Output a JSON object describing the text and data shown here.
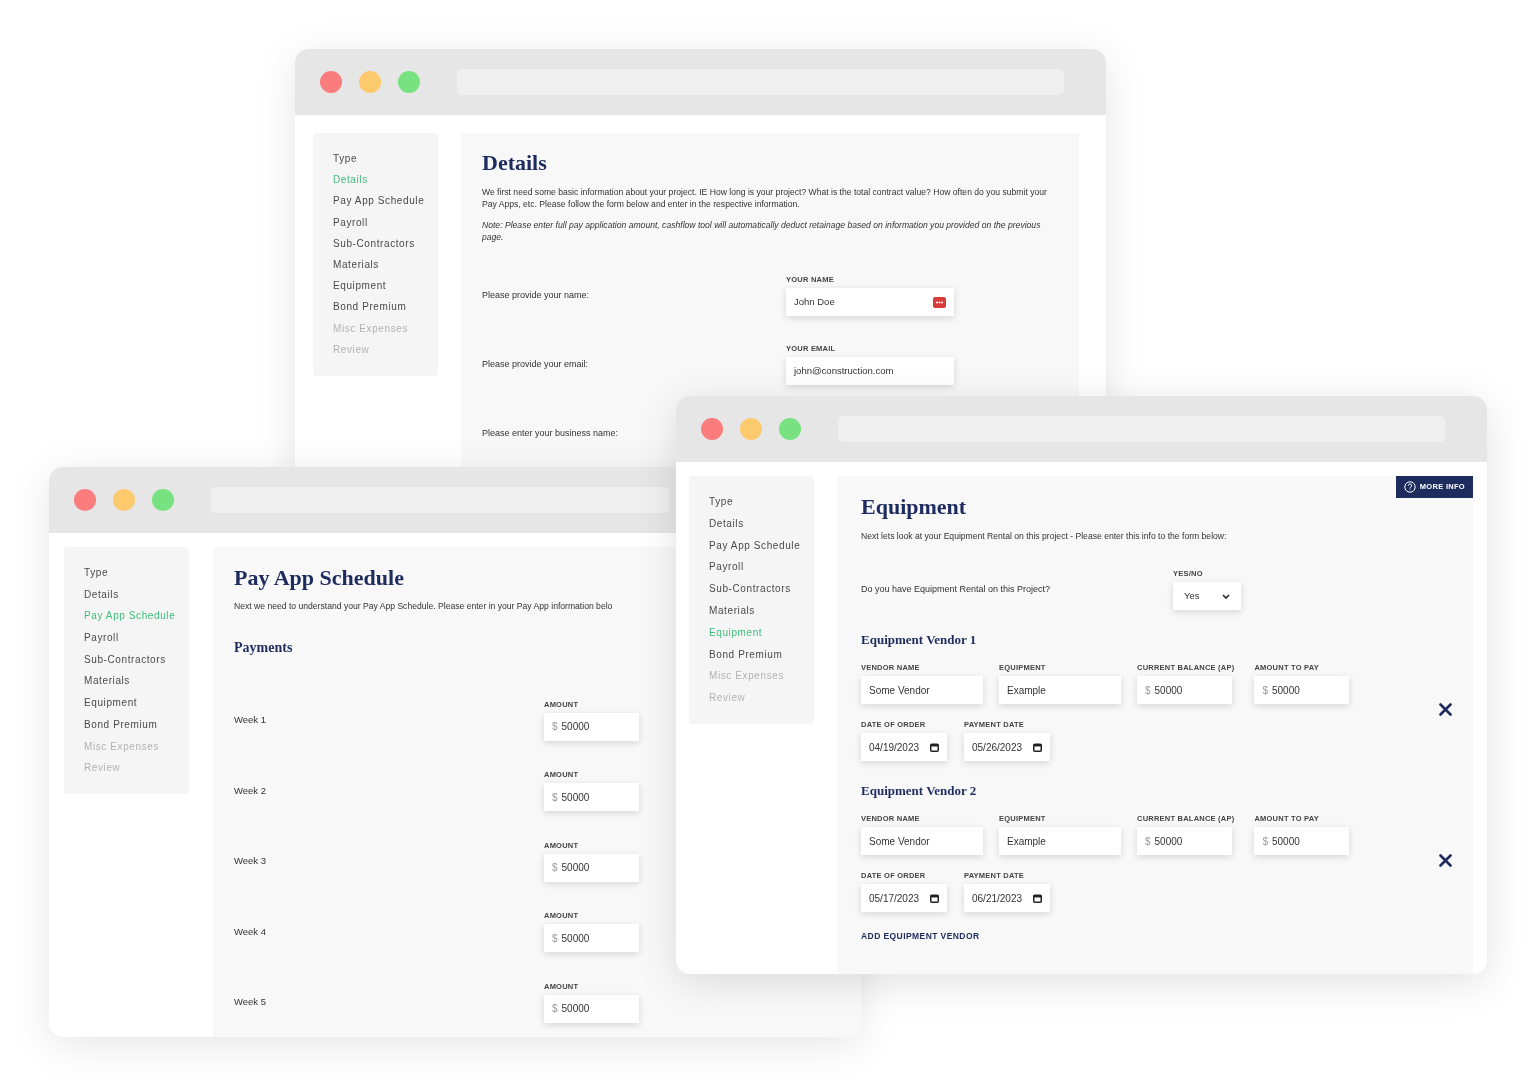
{
  "windows": [
    {
      "kind": "details",
      "sidebar": [
        {
          "label": "Type",
          "selected": false,
          "disabled": false
        },
        {
          "label": "Details",
          "selected": true,
          "disabled": false
        },
        {
          "label": "Pay App Schedule",
          "selected": false,
          "disabled": false
        },
        {
          "label": "Payroll",
          "selected": false,
          "disabled": false
        },
        {
          "label": "Sub-Contractors",
          "selected": false,
          "disabled": false
        },
        {
          "label": "Materials",
          "selected": false,
          "disabled": false
        },
        {
          "label": "Equipment",
          "selected": false,
          "disabled": false
        },
        {
          "label": "Bond Premium",
          "selected": false,
          "disabled": false
        },
        {
          "label": "Misc Expenses",
          "selected": false,
          "disabled": true
        },
        {
          "label": "Review",
          "selected": false,
          "disabled": true
        }
      ],
      "title": "Details",
      "intro": "We first need some basic information about your project. IE How long is your project? What is the total contract value? How often do you submit your Pay Apps, etc. Please follow the form below and enter in the respective information.",
      "note": "Note: Please enter full pay application amount, cashflow tool will automatically deduct retainage based on information you provided on the previous page.",
      "fields": [
        {
          "prompt": "Please provide your name:",
          "label": "YOUR NAME",
          "value": "John Doe",
          "autofill_icon": true
        },
        {
          "prompt": "Please provide your email:",
          "label": "YOUR EMAIL",
          "value": "john@construction.com",
          "autofill_icon": false
        },
        {
          "prompt": "Please enter your business name:"
        }
      ]
    },
    {
      "kind": "pay_app",
      "sidebar": [
        {
          "label": "Type",
          "selected": false,
          "disabled": false
        },
        {
          "label": "Details",
          "selected": false,
          "disabled": false
        },
        {
          "label": "Pay App Schedule",
          "selected": true,
          "disabled": false
        },
        {
          "label": "Payroll",
          "selected": false,
          "disabled": false
        },
        {
          "label": "Sub-Contractors",
          "selected": false,
          "disabled": false
        },
        {
          "label": "Materials",
          "selected": false,
          "disabled": false
        },
        {
          "label": "Equipment",
          "selected": false,
          "disabled": false
        },
        {
          "label": "Bond Premium",
          "selected": false,
          "disabled": false
        },
        {
          "label": "Misc Expenses",
          "selected": false,
          "disabled": true
        },
        {
          "label": "Review",
          "selected": false,
          "disabled": true
        }
      ],
      "title": "Pay App Schedule",
      "intro": "Next we need to understand your Pay App Schedule. Please enter in your Pay App information belo",
      "section": "Payments",
      "weeks": [
        {
          "label": "Week 1",
          "amount_label": "AMOUNT",
          "currency": "$",
          "value": "50000"
        },
        {
          "label": "Week 2",
          "amount_label": "AMOUNT",
          "currency": "$",
          "value": "50000"
        },
        {
          "label": "Week 3",
          "amount_label": "AMOUNT",
          "currency": "$",
          "value": "50000"
        },
        {
          "label": "Week 4",
          "amount_label": "AMOUNT",
          "currency": "$",
          "value": "50000"
        },
        {
          "label": "Week 5",
          "amount_label": "AMOUNT",
          "currency": "$",
          "value": "50000"
        }
      ]
    },
    {
      "kind": "equipment",
      "sidebar": [
        {
          "label": "Type",
          "selected": false,
          "disabled": false
        },
        {
          "label": "Details",
          "selected": false,
          "disabled": false
        },
        {
          "label": "Pay App Schedule",
          "selected": false,
          "disabled": false
        },
        {
          "label": "Payroll",
          "selected": false,
          "disabled": false
        },
        {
          "label": "Sub-Contractors",
          "selected": false,
          "disabled": false
        },
        {
          "label": "Materials",
          "selected": false,
          "disabled": false
        },
        {
          "label": "Equipment",
          "selected": true,
          "disabled": false
        },
        {
          "label": "Bond Premium",
          "selected": false,
          "disabled": false
        },
        {
          "label": "Misc Expenses",
          "selected": false,
          "disabled": true
        },
        {
          "label": "Review",
          "selected": false,
          "disabled": true
        }
      ],
      "more_info": "MORE INFO",
      "title": "Equipment",
      "intro": "Next lets look at your Equipment Rental on this project - Please enter this info to the form below:",
      "question": {
        "prompt": "Do you have Equipment Rental on this Project?",
        "label": "YES/NO",
        "value": "Yes"
      },
      "vendors": [
        {
          "heading": "Equipment Vendor 1",
          "fields": [
            {
              "label": "VENDOR NAME",
              "value": "Some Vendor"
            },
            {
              "label": "EQUIPMENT",
              "value": "Example"
            },
            {
              "label": "CURRENT BALANCE (AP)",
              "currency": "$",
              "value": "50000"
            },
            {
              "label": "AMOUNT TO PAY",
              "currency": "$",
              "value": "50000"
            }
          ],
          "dates": [
            {
              "label": "DATE OF ORDER",
              "value": "04/19/2023"
            },
            {
              "label": "PAYMENT DATE",
              "value": "05/26/2023"
            }
          ]
        },
        {
          "heading": "Equipment Vendor 2",
          "fields": [
            {
              "label": "VENDOR NAME",
              "value": "Some Vendor"
            },
            {
              "label": "EQUIPMENT",
              "value": "Example"
            },
            {
              "label": "CURRENT BALANCE (AP)",
              "currency": "$",
              "value": "50000"
            },
            {
              "label": "AMOUNT TO PAY",
              "currency": "$",
              "value": "50000"
            }
          ],
          "dates": [
            {
              "label": "DATE OF ORDER",
              "value": "05/17/2023"
            },
            {
              "label": "PAYMENT DATE",
              "value": "06/21/2023"
            }
          ]
        }
      ],
      "add_link": "ADD EQUIPMENT VENDOR"
    }
  ]
}
